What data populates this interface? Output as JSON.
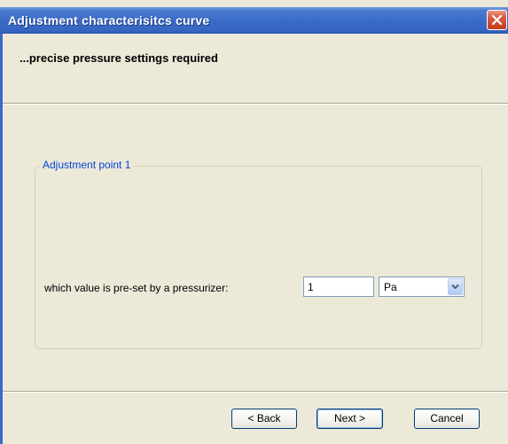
{
  "window": {
    "title": "Adjustment characterisitcs curve"
  },
  "header": {
    "text": "...precise pressure settings required"
  },
  "group": {
    "legend": "Adjustment point 1",
    "field_label": "which value is pre-set by a pressurizer:",
    "value": "1",
    "unit": "Pa"
  },
  "buttons": {
    "back": "< Back",
    "next": "Next >",
    "cancel": "Cancel"
  },
  "colors": {
    "titlebar": "#3a6bc8",
    "legend": "#0046d5",
    "dialog_bg": "#ece9d8"
  },
  "icons": [
    "close-icon",
    "chevron-down-icon"
  ]
}
